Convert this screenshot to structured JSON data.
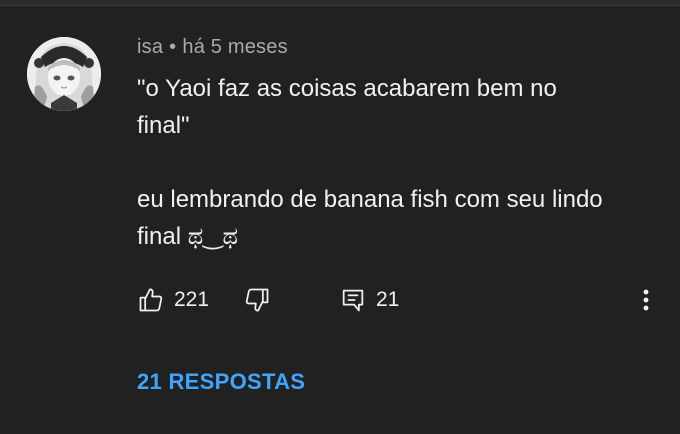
{
  "comment": {
    "author": "isa",
    "separator": "•",
    "time": "há 5 meses",
    "text_line1": "\"o Yaoi faz as coisas acabarem bem no",
    "text_line2": "final\"",
    "text_line3": "eu lembrando de banana fish com seu lindo",
    "text_line4": "final ಥ‿ಥ",
    "likes": "221",
    "replies_count": "21",
    "replies_label": "21 RESPOSTAS"
  },
  "colors": {
    "background": "#212121",
    "text": "#f1f1f1",
    "meta": "#aaaaaa",
    "link": "#3ea6ff"
  },
  "icons": [
    "like-icon",
    "dislike-icon",
    "reply-icon",
    "more-vert-icon"
  ]
}
